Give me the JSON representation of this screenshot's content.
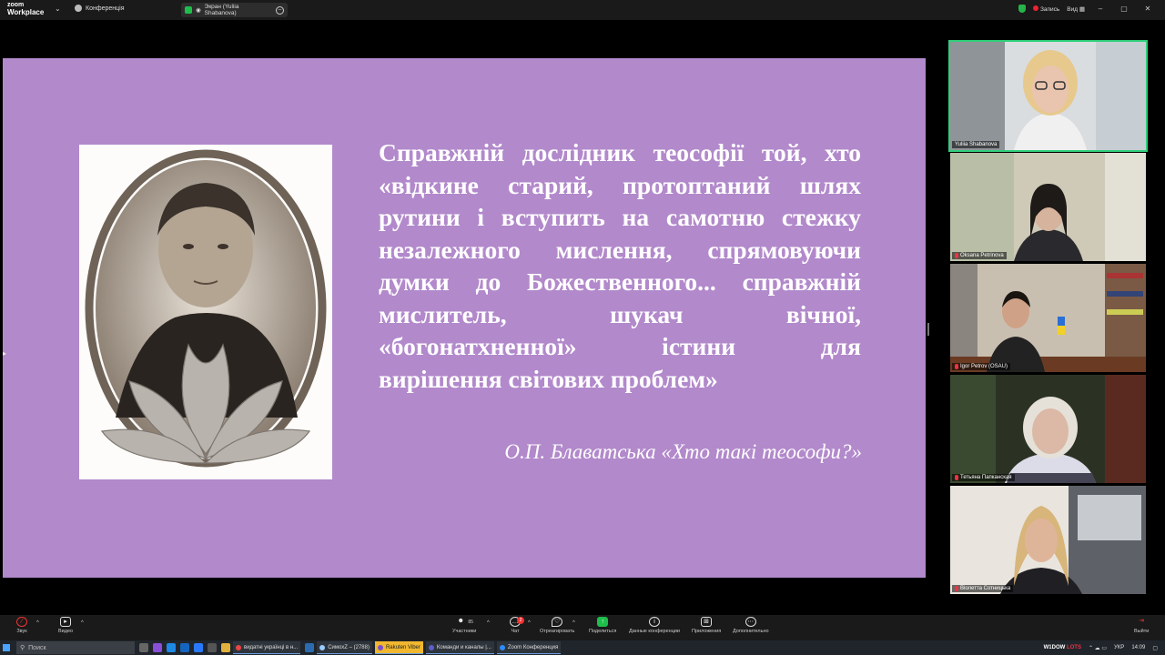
{
  "topbar": {
    "logo_line1": "zoom",
    "logo_line2": "Workplace",
    "conference_label": "Конференція",
    "share_label": "Экран (Yuliia Shabanova)",
    "recording_label": "Запись",
    "view_label": "Вид",
    "window_controls": [
      "–",
      "▢",
      "✕"
    ]
  },
  "slide": {
    "background": "#b289cb",
    "quote_lines": [
      "Справжній дослідник теософії той, хто",
      "«відкине старий, протоптаний шлях",
      "рутини і вступить на самотню стежку",
      "незалежного мислення, спрямовуючи",
      "думки до Божественного... справжній",
      "мислитель, шукач вічної,",
      "«богонатхненної» істини для",
      "вирішення світових проблем»"
    ],
    "citation": "О.П. Блаватська «Хто такі теософи?»"
  },
  "participants": [
    {
      "name": "Yuliia Shabanova",
      "muted": false,
      "active": true
    },
    {
      "name": "Oksana Petrinova",
      "muted": true,
      "active": false
    },
    {
      "name": "Igor Petrov (OSAU)",
      "muted": true,
      "active": false
    },
    {
      "name": "Тетьяна Папканская",
      "muted": true,
      "active": false
    },
    {
      "name": "Віолетта Сотницька",
      "muted": true,
      "active": false
    }
  ],
  "toolbar": {
    "audio_label": "Звук",
    "video_label": "Видео",
    "participants_label": "Участники",
    "participants_count": "85",
    "chat_label": "Чат",
    "chat_badge": "2",
    "react_label": "Отреагировать",
    "share_label": "Поделиться",
    "info_label": "Данные конференции",
    "apps_label": "Приложения",
    "more_label": "Дополнительно",
    "leave_label": "Выйти"
  },
  "taskbar": {
    "search_placeholder": "Поиск",
    "tasks": [
      "видатні українці в н...",
      "СимохZ – (2788)",
      "Rakuten Viber",
      "Команди и каналы |...",
      "Zoom Конференция"
    ],
    "tray_brand_a": "W1DOW",
    "tray_brand_b": "LOTS",
    "tray_lang": "УКР",
    "tray_time": "14:09"
  }
}
